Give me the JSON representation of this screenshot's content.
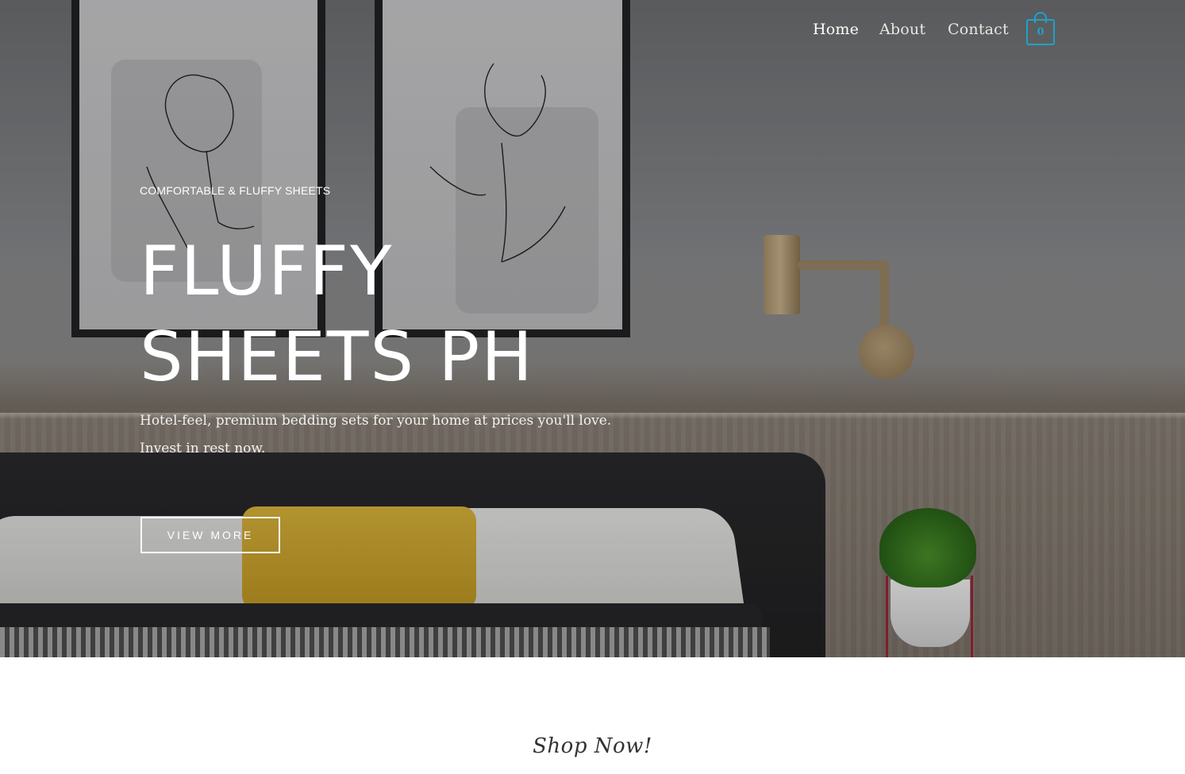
{
  "nav": {
    "items": [
      {
        "label": "Home"
      },
      {
        "label": "About"
      },
      {
        "label": "Contact"
      }
    ],
    "cart_count": "0"
  },
  "hero": {
    "eyebrow": "COMFORTABLE & FLUFFY SHEETS",
    "headline": "FLUFFY SHEETS PH",
    "subtext": "Hotel-feel, premium bedding sets for your home at prices you'll love. Invest in rest now.",
    "cta_label": "VIEW MORE"
  },
  "section": {
    "title": "Shop Now!"
  },
  "colors": {
    "accent": "#1ea3c4",
    "text_light": "#ffffff",
    "heading_dark": "#333333"
  },
  "icons": [
    "shopping-bag-icon"
  ]
}
